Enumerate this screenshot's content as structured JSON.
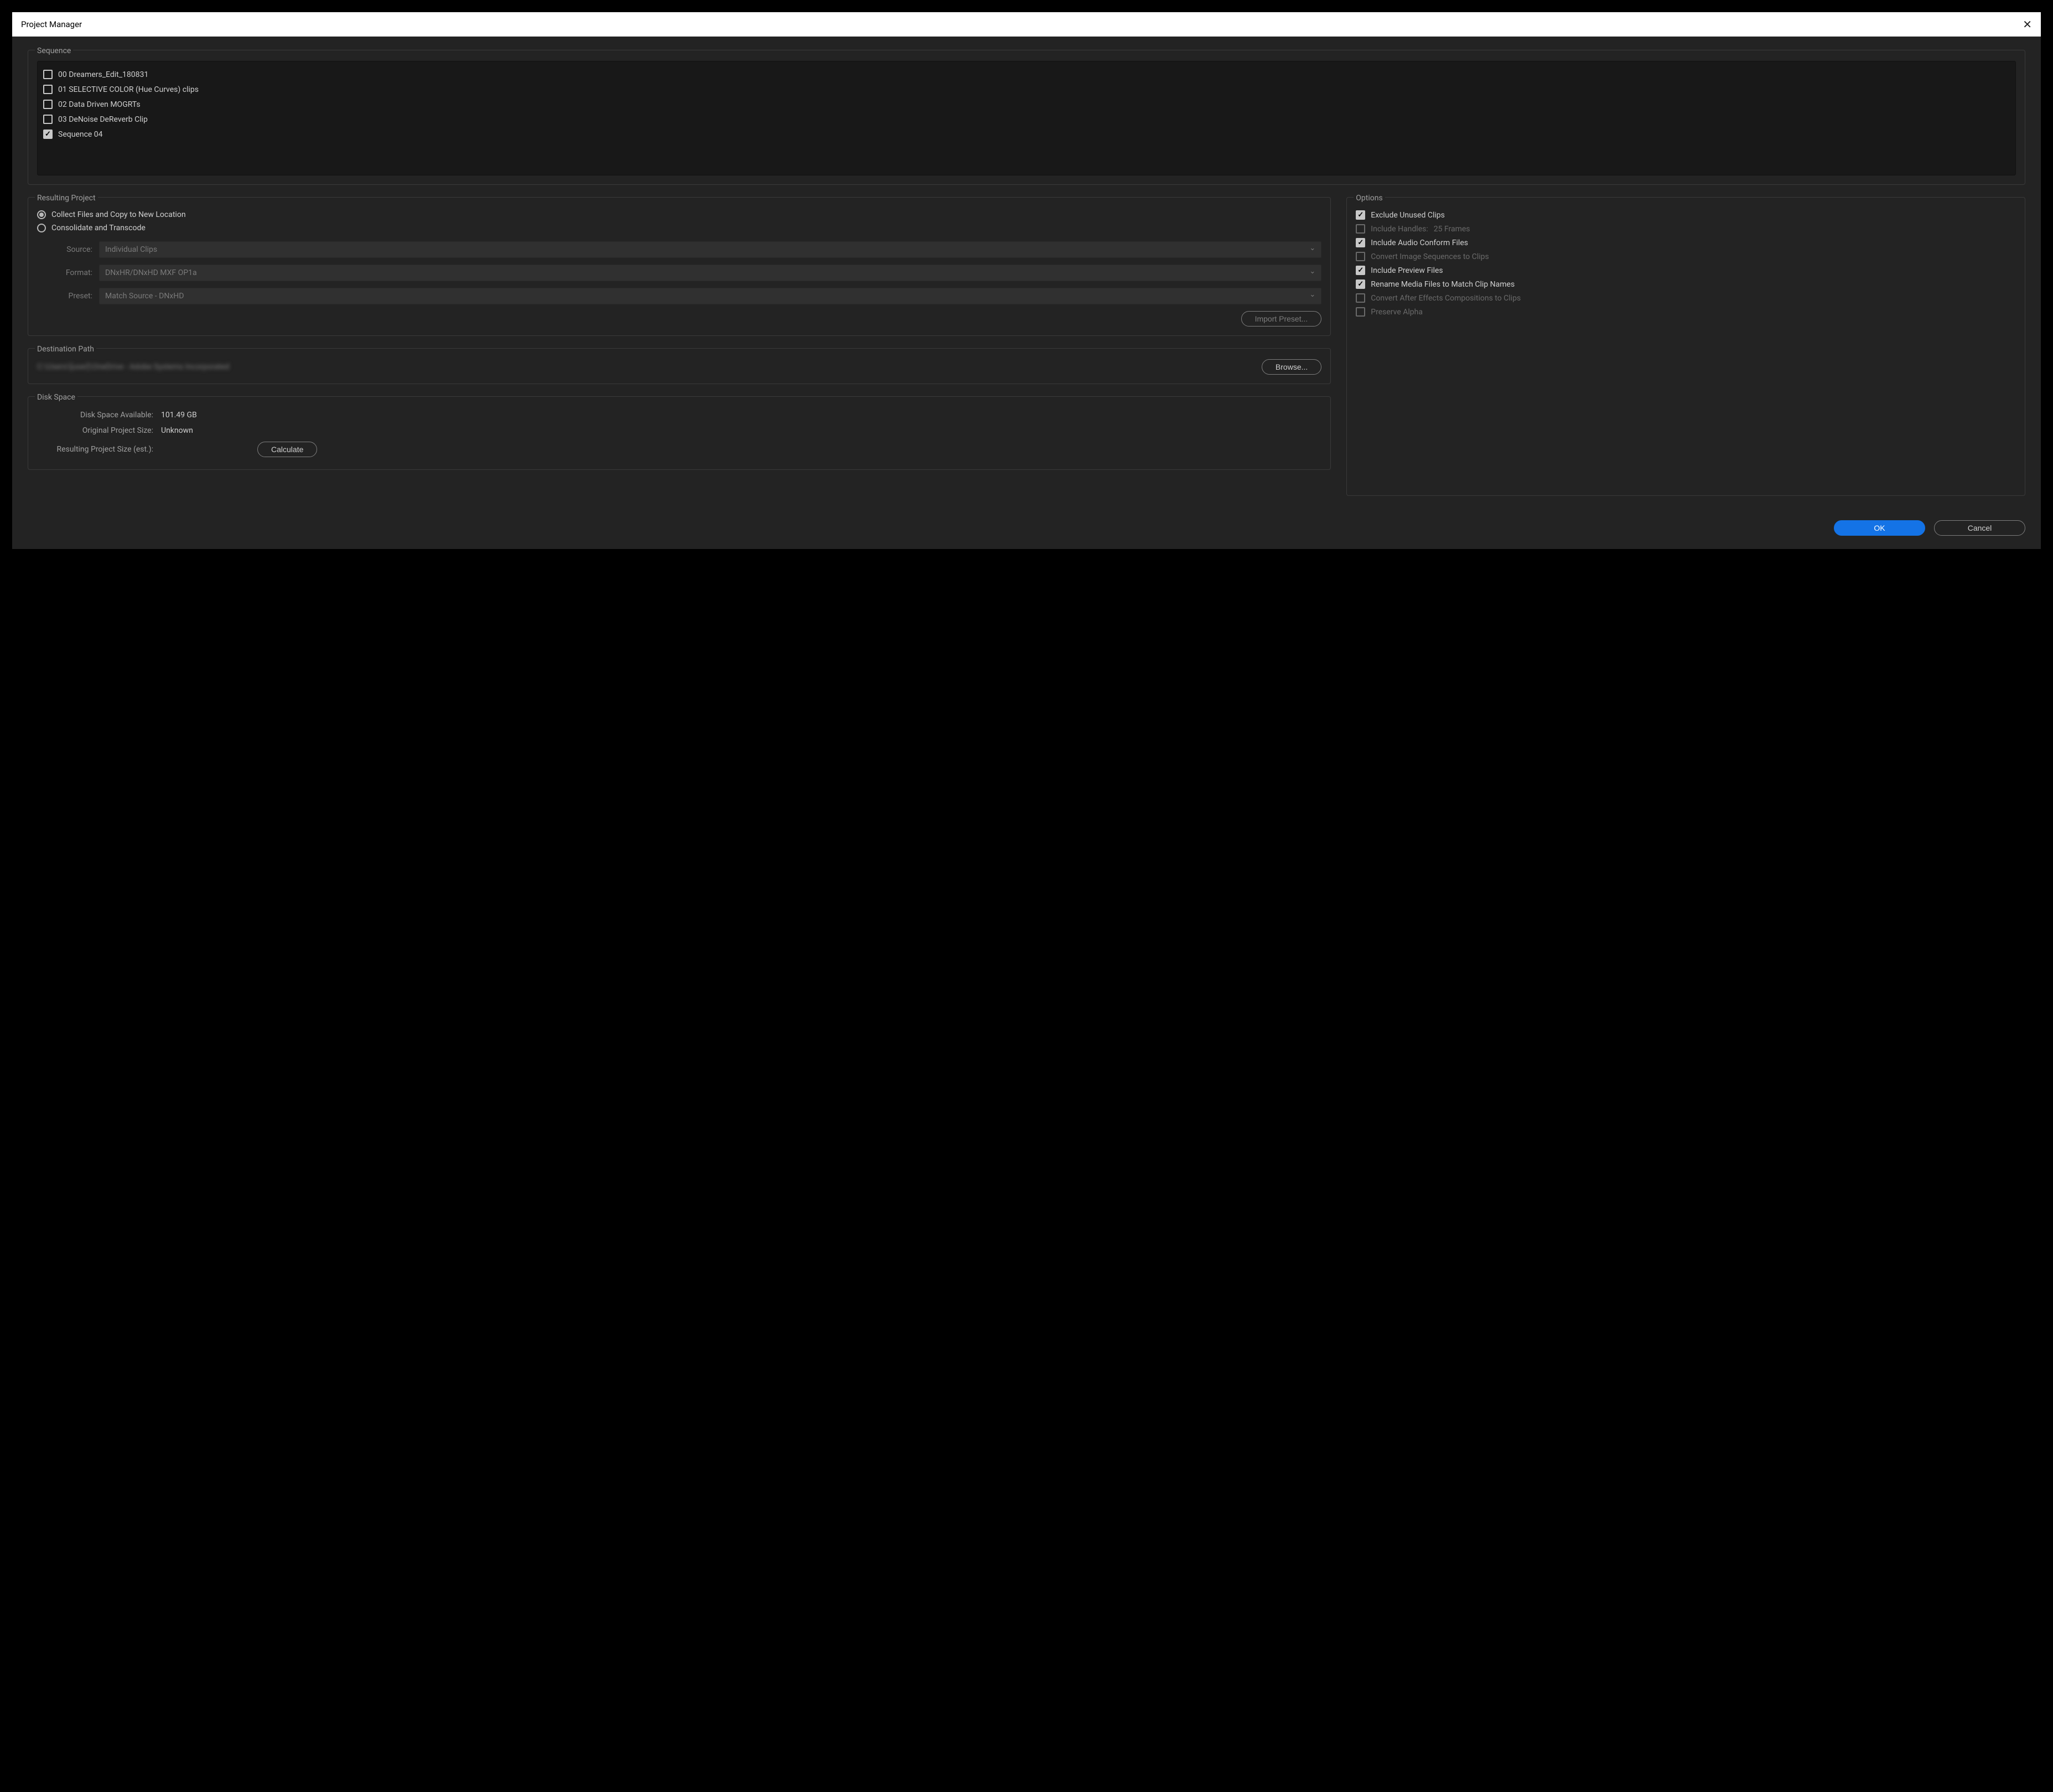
{
  "window": {
    "title": "Project Manager"
  },
  "sequence": {
    "label": "Sequence",
    "items": [
      {
        "label": "00 Dreamers_Edit_180831",
        "checked": false
      },
      {
        "label": "01 SELECTIVE COLOR (Hue Curves) clips",
        "checked": false
      },
      {
        "label": "02 Data Driven MOGRTs",
        "checked": false
      },
      {
        "label": "03 DeNoise DeReverb Clip",
        "checked": false
      },
      {
        "label": "Sequence 04",
        "checked": true
      }
    ]
  },
  "resulting": {
    "label": "Resulting Project",
    "radios": [
      {
        "label": "Collect Files and Copy to New Location",
        "selected": true
      },
      {
        "label": "Consolidate and Transcode",
        "selected": false
      }
    ],
    "source_label": "Source:",
    "source_value": "Individual Clips",
    "format_label": "Format:",
    "format_value": "DNxHR/DNxHD MXF OP1a",
    "preset_label": "Preset:",
    "preset_value": "Match Source - DNxHD",
    "import_preset_btn": "Import Preset..."
  },
  "destination": {
    "label": "Destination Path",
    "path": "C:\\Users\\[user]\\OneDrive - Adobe Systems Incorporated",
    "browse_btn": "Browse..."
  },
  "disk": {
    "label": "Disk Space",
    "avail_label": "Disk Space Available:",
    "avail_value": "101.49 GB",
    "orig_label": "Original Project Size:",
    "orig_value": "Unknown",
    "est_label": "Resulting Project Size (est.):",
    "est_value": "",
    "calculate_btn": "Calculate"
  },
  "options": {
    "label": "Options",
    "items": [
      {
        "label": "Exclude Unused Clips",
        "checked": true,
        "disabled": false
      },
      {
        "label": "Include Handles:",
        "extra": "25 Frames",
        "checked": false,
        "disabled": true
      },
      {
        "label": "Include Audio Conform Files",
        "checked": true,
        "disabled": false
      },
      {
        "label": "Convert Image Sequences to Clips",
        "checked": false,
        "disabled": true
      },
      {
        "label": "Include Preview Files",
        "checked": true,
        "disabled": false
      },
      {
        "label": "Rename Media Files to Match Clip Names",
        "checked": true,
        "disabled": false
      },
      {
        "label": "Convert After Effects Compositions to Clips",
        "checked": false,
        "disabled": true
      },
      {
        "label": "Preserve Alpha",
        "checked": false,
        "disabled": true
      }
    ]
  },
  "footer": {
    "ok": "OK",
    "cancel": "Cancel"
  }
}
